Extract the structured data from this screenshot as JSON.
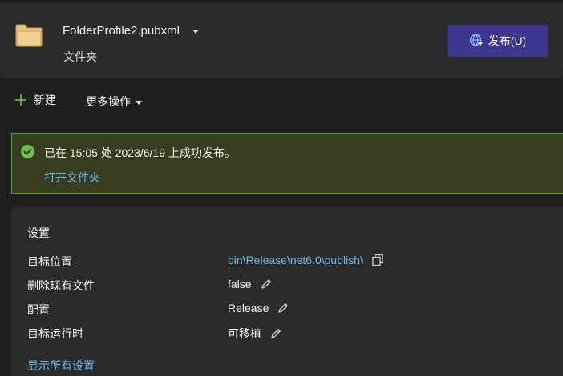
{
  "profile": {
    "name": "FolderProfile2.pubxml",
    "type": "文件夹",
    "folder_icon": "folder-icon",
    "dropdown_icon": "chevron-down-icon"
  },
  "publish_button": {
    "label": "发布(U)",
    "icon": "globe-publish-icon",
    "color": "#3f3690"
  },
  "toolbar": {
    "new_label": "新建",
    "new_icon": "plus-icon",
    "more_actions_label": "更多操作",
    "more_actions_icon": "chevron-down-icon"
  },
  "success_banner": {
    "message": "已在 15:05 处 2023/6/19 上成功发布。",
    "open_folder_link": "打开文件夹",
    "icon": "check-circle-icon",
    "accent_color": "#5e9e3b"
  },
  "settings": {
    "title": "设置",
    "rows": [
      {
        "label": "目标位置",
        "value": "bin\\Release\\net6.0\\publish\\",
        "action_icon": "copy-icon"
      },
      {
        "label": "删除现有文件",
        "value": "false",
        "action_icon": "pencil-icon"
      },
      {
        "label": "配置",
        "value": "Release",
        "action_icon": "pencil-icon"
      },
      {
        "label": "目标运行时",
        "value": "可移植",
        "action_icon": "pencil-icon"
      }
    ],
    "show_all_link": "显示所有设置"
  },
  "colors": {
    "background": "#1f1f1f",
    "card": "#2b2b2b",
    "link": "#6fb6e8",
    "success_bg": "#393d1f"
  }
}
